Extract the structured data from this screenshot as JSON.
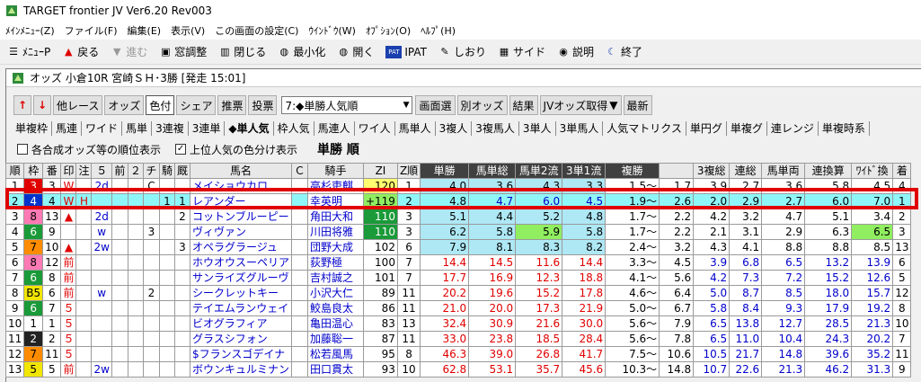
{
  "title": "TARGET frontier JV  Ver6.20  Rev003",
  "menu": [
    "ﾒｲﾝﾒﾆｭｰ(Z)",
    "ファイル(F)",
    "編集(E)",
    "表示(V)",
    "この画面の設定(C)",
    "ｳｲﾝﾄﾞｳ(W)",
    "ｵﾌﾟｼｮﾝ(O)",
    "ﾍﾙﾌﾟ(H)"
  ],
  "toolbar": [
    "ﾒﾆｭｰP",
    "戻る",
    "進む",
    "窓調整",
    "閉じる",
    "最小化",
    "開く",
    "IPAT",
    "しおり",
    "サイド",
    "説明",
    "終了"
  ],
  "window_title": "オッズ 小倉10R 宮崎ＳＨ･3勝 [発走 15:01]",
  "controls": {
    "up": "↑",
    "down": "↓",
    "prev_race": "他レース",
    "odds": "オッズ",
    "color": "色付",
    "share": "シェア",
    "pick": "推票",
    "vote": "投票",
    "select_value": "7:◆単勝人気順",
    "screen_select": "画面選",
    "other_odds": "別オッズ",
    "result": "結果",
    "jv_odds": "JVオッズ取得",
    "jv_arrow": "▼",
    "latest": "最新"
  },
  "tabs": [
    "単複枠",
    "馬連",
    "ワイド",
    "馬単",
    "3連複",
    "3連単",
    "◆単人気",
    "枠人気",
    "馬連人",
    "ワイ人",
    "馬単人",
    "3複人",
    "3複馬人",
    "3単人",
    "3単馬人",
    "人気マトリクス",
    "単円グ",
    "単複グ",
    "連レンジ",
    "単複時系"
  ],
  "options": {
    "cb1": "各合成オッズ等の順位表示",
    "cb1_checked": "",
    "cb2": "上位人気の色分け表示",
    "cb2_checked": "✓",
    "heading": "単勝 順"
  },
  "headers": [
    "順",
    "枠",
    "番",
    "印",
    "注",
    "５",
    "前",
    "２",
    "チ",
    "騎",
    "厩",
    "馬名",
    "Ｃ",
    "騎手",
    "ZI",
    "Z順",
    "単勝",
    "馬単総",
    "馬単2流",
    "3単1流",
    "複勝",
    "",
    "3複総",
    "連総",
    "馬単両",
    "連換算",
    "ﾜｲﾄﾞ換",
    "着"
  ],
  "rows": [
    [
      "1",
      "3",
      "3",
      "W",
      "",
      "2d",
      "",
      "",
      "C",
      "",
      "",
      "メイショウカロ",
      "",
      "高杉吏麒",
      "120",
      "1",
      "4.0",
      "3.6",
      "4.3",
      "3.3",
      "1.5～",
      "1.7",
      "3.9",
      "2.7",
      "3.6",
      "5.8",
      "4.5",
      "4"
    ],
    [
      "2",
      "4",
      "4",
      "W",
      "H",
      "",
      "",
      "",
      "",
      "1",
      "1",
      "レアンダー",
      "",
      "幸英明",
      "+119",
      "2",
      "4.8",
      "4.7",
      "6.0",
      "4.5",
      "1.9～",
      "2.6",
      "2.0",
      "2.9",
      "2.7",
      "6.0",
      "7.0",
      "1"
    ],
    [
      "3",
      "8",
      "13",
      "▲",
      "",
      "2d",
      "",
      "",
      "",
      "",
      "2",
      "コットンブルーピー",
      "",
      "角田大和",
      "110",
      "3",
      "5.1",
      "4.4",
      "5.2",
      "4.8",
      "1.7～",
      "2.2",
      "4.2",
      "3.2",
      "4.7",
      "5.1",
      "3.4",
      "2"
    ],
    [
      "4",
      "6",
      "9",
      "",
      "",
      "w",
      "",
      "",
      "3",
      "",
      "",
      "ヴィヴァン",
      "",
      "川田将雅",
      "110",
      "3",
      "6.2",
      "5.8",
      "5.9",
      "5.8",
      "1.7～",
      "2.2",
      "2.1",
      "3.1",
      "2.9",
      "6.3",
      "6.5",
      "3"
    ],
    [
      "5",
      "7",
      "10",
      "▲",
      "",
      "2w",
      "",
      "",
      "",
      "",
      "3",
      "オペラグラージュ",
      "",
      "団野大成",
      "102",
      "6",
      "7.9",
      "8.1",
      "8.3",
      "8.2",
      "2.4～",
      "3.2",
      "4.3",
      "4.1",
      "8.8",
      "8.8",
      "8.5",
      "13"
    ],
    [
      "6",
      "8",
      "12",
      "前",
      "",
      "",
      "",
      "",
      "",
      "",
      "",
      "ホウオウスーペリア",
      "",
      "荻野極",
      "100",
      "7",
      "14.4",
      "14.5",
      "11.6",
      "14.4",
      "3.3～",
      "4.5",
      "3.9",
      "6.8",
      "6.5",
      "13.2",
      "13.9",
      "6"
    ],
    [
      "7",
      "6",
      "8",
      "前",
      "",
      "",
      "",
      "",
      "",
      "",
      "",
      "サンライズグルーヴ",
      "",
      "吉村誠之",
      "101",
      "7",
      "17.7",
      "16.9",
      "12.3",
      "18.8",
      "4.1～",
      "5.6",
      "4.2",
      "7.3",
      "7.2",
      "15.2",
      "12.6",
      "5"
    ],
    [
      "8",
      "B5",
      "6",
      "前",
      "",
      "w",
      "",
      "",
      "2",
      "",
      "",
      "シークレットキー",
      "",
      "小沢大仁",
      "89",
      "11",
      "20.2",
      "19.6",
      "15.2",
      "17.8",
      "4.6～",
      "6.4",
      "5.0",
      "8.7",
      "8.5",
      "18.0",
      "15.7",
      "12"
    ],
    [
      "9",
      "6",
      "7",
      "５",
      "",
      "",
      "",
      "",
      "",
      "",
      "",
      "テイエムランウェイ",
      "",
      "鮫島良太",
      "86",
      "11",
      "21.0",
      "20.0",
      "17.3",
      "21.9",
      "5.0～",
      "6.7",
      "5.8",
      "8.4",
      "9.3",
      "17.9",
      "19.2",
      "8"
    ],
    [
      "10",
      "1",
      "1",
      "５",
      "",
      "",
      "",
      "",
      "",
      "",
      "",
      "ビオグラフィア",
      "",
      "亀田温心",
      "83",
      "13",
      "32.4",
      "30.9",
      "21.6",
      "30.0",
      "5.6～",
      "7.9",
      "6.5",
      "13.8",
      "12.7",
      "28.5",
      "21.3",
      "10"
    ],
    [
      "11",
      "2",
      "2",
      "５",
      "",
      "",
      "",
      "",
      "",
      "",
      "",
      "グラスシフォン",
      "",
      "加藤聡一",
      "87",
      "11",
      "33.0",
      "23.8",
      "18.5",
      "28.4",
      "5.6～",
      "7.8",
      "6.5",
      "11.0",
      "10.4",
      "24.3",
      "20.2",
      "7"
    ],
    [
      "12",
      "7",
      "11",
      "５",
      "",
      "",
      "",
      "",
      "",
      "",
      "",
      "$フランスゴデイナ",
      "",
      "松若風馬",
      "95",
      "8",
      "46.3",
      "39.0",
      "26.8",
      "41.7",
      "7.5～",
      "10.6",
      "10.5",
      "21.7",
      "14.8",
      "39.6",
      "35.2",
      "11"
    ],
    [
      "13",
      "5",
      "5",
      "前",
      "",
      "2w",
      "",
      "",
      "",
      "",
      "",
      "ボウンキュルミナン",
      "",
      "田口貫太",
      "93",
      "10",
      "62.8",
      "53.1",
      "35.7",
      "45.6",
      "10.3～",
      "14.8",
      "10.7",
      "22.6",
      "21.3",
      "46.2",
      "31.3",
      "9"
    ]
  ]
}
